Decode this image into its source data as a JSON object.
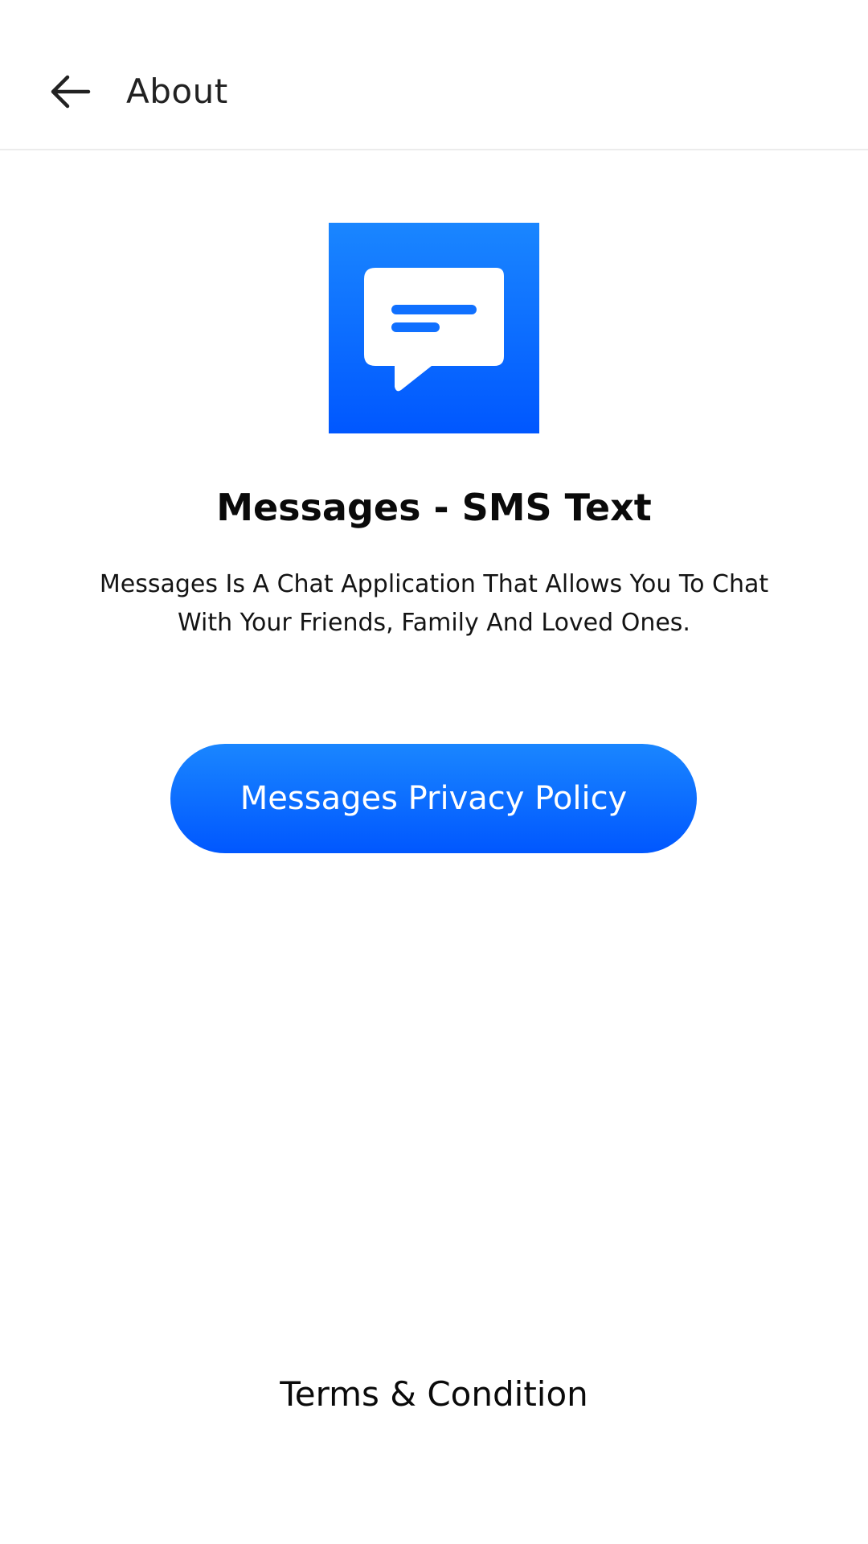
{
  "app_bar": {
    "back_icon": "arrow-left-icon",
    "title": "About"
  },
  "about": {
    "app_icon": "chat-bubble-icon",
    "app_name": "Messages - SMS Text",
    "description": "Messages Is A Chat Application That Allows You To Chat With Your Friends, Family And Loved Ones.",
    "privacy_button_label": "Messages Privacy Policy",
    "terms_label": "Terms & Condition"
  },
  "colors": {
    "accent_top": "#1a86ff",
    "accent_bottom": "#0057ff",
    "background": "#ffffff",
    "text": "#0a0a0a"
  }
}
